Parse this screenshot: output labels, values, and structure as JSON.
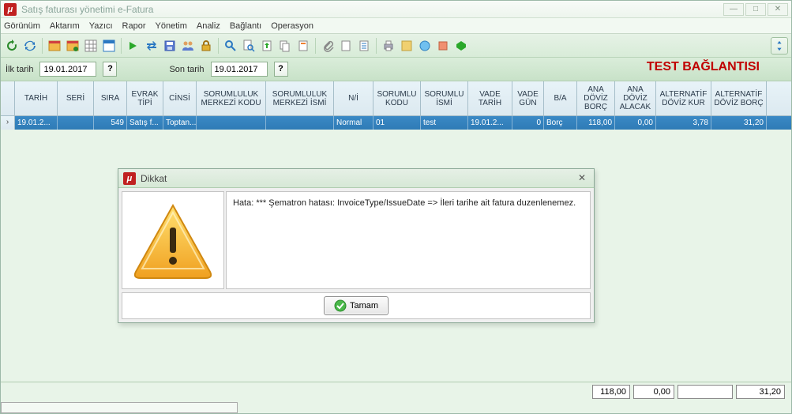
{
  "window": {
    "title": "Satış faturası yönetimi e-Fatura"
  },
  "menu": [
    "Görünüm",
    "Aktarım",
    "Yazıcı",
    "Rapor",
    "Yönetim",
    "Analiz",
    "Bağlantı",
    "Operasyon"
  ],
  "filter": {
    "first_date_label": "İlk tarih",
    "first_date_value": "19.01.2017",
    "last_date_label": "Son tarih",
    "last_date_value": "19.01.2017",
    "help_label": "?",
    "test_header": "TEST BAĞLANTISI"
  },
  "grid": {
    "columns": [
      "TARİH",
      "SERİ",
      "SIRA",
      "EVRAK TİPİ",
      "CİNSİ",
      "SORUMLULUK MERKEZİ KODU",
      "SORUMLULUK MERKEZİ İSMİ",
      "N/İ",
      "SORUMLU KODU",
      "SORUMLU İSMİ",
      "VADE TARİH",
      "VADE GÜN",
      "B/A",
      "ANA DÖVİZ BORÇ",
      "ANA DÖVİZ ALACAK",
      "ALTERNATİF DÖVİZ KUR",
      "ALTERNATİF DÖVİZ BORÇ"
    ],
    "row": {
      "tarih": "19.01.2...",
      "seri": "",
      "sira": "549",
      "evrak_tipi": "Satış f...",
      "cinsi": "Toptan...",
      "sm_kodu": "",
      "sm_ismi": "",
      "ni": "Normal",
      "sorumlu_kodu": "01",
      "sorumlu_ismi": "test",
      "vade_tarih": "19.01.2...",
      "vade_gun": "0",
      "ba": "Borç",
      "ana_borc": "118,00",
      "ana_alacak": "0,00",
      "alt_kur": "3,78",
      "alt_borc": "31,20"
    }
  },
  "dialog": {
    "title": "Dikkat",
    "message": "Hata: *** Şematron hatası: InvoiceType/IssueDate => İleri tarihe ait fatura duzenlenemez.",
    "ok_label": "Tamam"
  },
  "footer": {
    "totals": [
      "118,00",
      "0,00",
      "",
      "31,20"
    ]
  }
}
